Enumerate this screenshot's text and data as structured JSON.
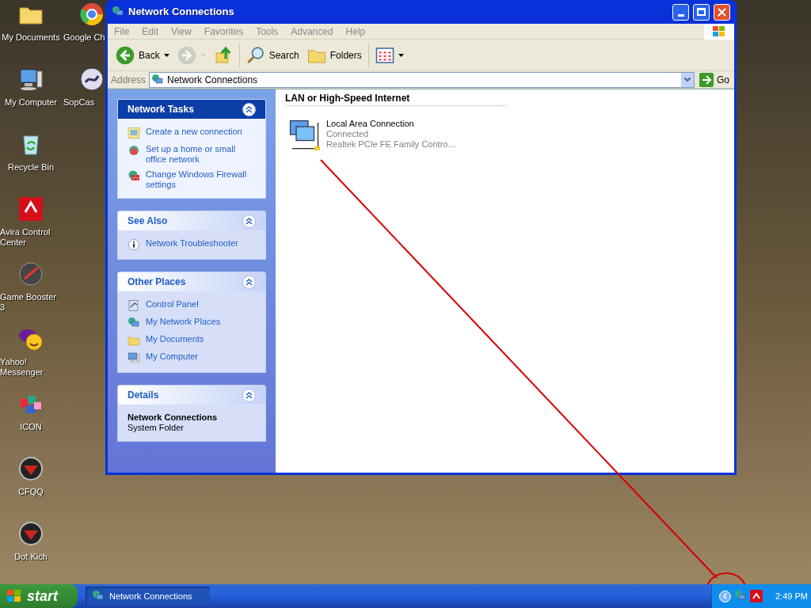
{
  "desktop_columns": [
    {
      "icons": [
        {
          "label": "My Documents",
          "kind": "folder"
        },
        {
          "label": "My Computer",
          "kind": "computer"
        },
        {
          "label": "Recycle Bin",
          "kind": "recycle"
        },
        {
          "label": "Avira Control Center",
          "kind": "antivirus"
        },
        {
          "label": "Game Booster 3",
          "kind": "gauge"
        },
        {
          "label": "Yahoo! Messenger",
          "kind": "messenger"
        },
        {
          "label": "ICON",
          "kind": "cubes"
        },
        {
          "label": "CFQQ",
          "kind": "game"
        },
        {
          "label": "Dot Kich",
          "kind": "game"
        }
      ]
    },
    {
      "icons": [
        {
          "label": "Google Ch",
          "kind": "browser"
        },
        {
          "label": "SopCas",
          "kind": "media"
        }
      ]
    }
  ],
  "window": {
    "title": "Network Connections",
    "menu": [
      "File",
      "Edit",
      "View",
      "Favorites",
      "Tools",
      "Advanced",
      "Help"
    ],
    "toolbar": [
      {
        "kind": "back",
        "label": "Back",
        "disabled": false
      },
      {
        "kind": "forward",
        "disabled": true
      },
      {
        "kind": "up",
        "disabled": false
      },
      {
        "kind": "search",
        "label": "Search",
        "disabled": false
      },
      {
        "kind": "folders",
        "label": "Folders",
        "disabled": false
      },
      {
        "kind": "views",
        "disabled": false
      }
    ],
    "address": {
      "label": "Address",
      "value": "Network Connections",
      "go": "Go"
    },
    "sidebar": [
      {
        "title": "Network Tasks",
        "primary": true,
        "items": [
          {
            "label": "Create a new connection",
            "kind": "wizard"
          },
          {
            "label": "Set up a home or small office network",
            "kind": "home"
          },
          {
            "label": "Change Windows Firewall settings",
            "kind": "firewall"
          }
        ]
      },
      {
        "title": "See Also",
        "primary": false,
        "items": [
          {
            "label": "Network Troubleshooter",
            "kind": "info"
          }
        ]
      },
      {
        "title": "Other Places",
        "primary": false,
        "items": [
          {
            "label": "Control Panel",
            "kind": "control"
          },
          {
            "label": "My Network Places",
            "kind": "network"
          },
          {
            "label": "My Documents",
            "kind": "documents"
          },
          {
            "label": "My Computer",
            "kind": "computer"
          }
        ]
      },
      {
        "title": "Details",
        "primary": false,
        "details": {
          "name": "Network Connections",
          "type": "System Folder"
        }
      }
    ],
    "groups": [
      {
        "heading": "LAN or High-Speed Internet",
        "connections": [
          {
            "name": "Local Area Connection",
            "status": "Connected",
            "device": "Realtek PCIe FE Family Contro…"
          }
        ]
      }
    ]
  },
  "taskbar": {
    "start": "start",
    "tasks": [
      {
        "label": "Network Connections",
        "selected": true
      }
    ],
    "clock": "2:49 PM"
  }
}
